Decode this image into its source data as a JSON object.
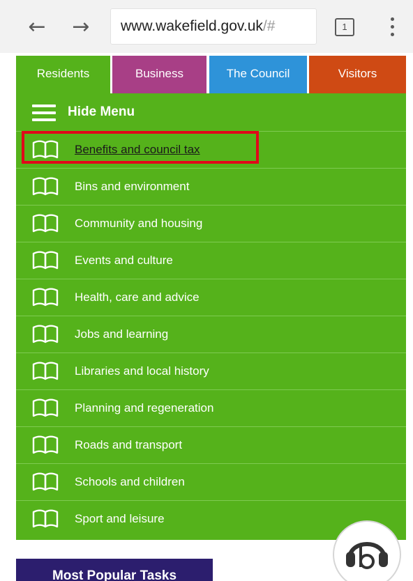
{
  "browser": {
    "back_icon": "arrow-left-icon",
    "forward_icon": "arrow-right-icon",
    "url_main": "www.wakefield.gov.uk",
    "url_muted": "/#",
    "tab_count": "1",
    "menu_icon": "kebab-menu-icon"
  },
  "tabs": [
    {
      "label": "Residents",
      "color": "#55b21b"
    },
    {
      "label": "Business",
      "color": "#a83f86"
    },
    {
      "label": "The Council",
      "color": "#2e93d9"
    },
    {
      "label": "Visitors",
      "color": "#cf4a14"
    }
  ],
  "menu": {
    "toggle_label": "Hide Menu",
    "toggle_icon": "hamburger-icon",
    "item_icon": "book-icon",
    "background_color": "#55b21b",
    "items": [
      {
        "label": "Benefits and council tax",
        "highlighted": true
      },
      {
        "label": "Bins and environment"
      },
      {
        "label": "Community and housing"
      },
      {
        "label": "Events and culture"
      },
      {
        "label": "Health, care and advice"
      },
      {
        "label": "Jobs and learning"
      },
      {
        "label": "Libraries and local history"
      },
      {
        "label": "Planning and regeneration"
      },
      {
        "label": "Roads and transport"
      },
      {
        "label": "Schools and children"
      },
      {
        "label": "Sport and leisure"
      }
    ]
  },
  "highlight_color": "#e0081a",
  "popular": {
    "label": "Most Popular Tasks",
    "color": "#2c1e6e"
  },
  "browsealoud": {
    "icon": "headphones-b-icon"
  }
}
